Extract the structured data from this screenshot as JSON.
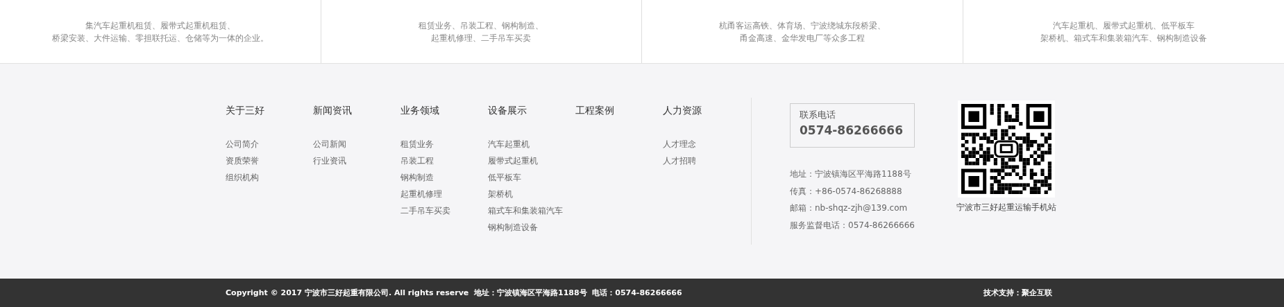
{
  "summary_cards": [
    {
      "lines": [
        "集汽车起重机租赁、履带式起重机租赁、",
        "桥梁安装、大件运输、零担联托运、仓储等为一体的企业。"
      ]
    },
    {
      "lines": [
        "租赁业务、吊装工程、钢构制造、",
        "起重机修理、二手吊车买卖"
      ]
    },
    {
      "lines": [
        "杭甬客运高铁、体育场、宁波绕城东段桥梁、",
        "甬金高速、金华发电厂等众多工程"
      ]
    },
    {
      "lines": [
        "汽车起重机、履带式起重机、低平板车",
        "架桥机、箱式车和集装箱汽车、钢构制造设备"
      ]
    }
  ],
  "footer_nav": [
    {
      "heading": "关于三好",
      "links": [
        "公司简介",
        "资质荣誉",
        "组织机构"
      ]
    },
    {
      "heading": "新闻资讯",
      "links": [
        "公司新闻",
        "行业资讯"
      ]
    },
    {
      "heading": "业务领域",
      "links": [
        "租赁业务",
        "吊装工程",
        "钢构制造",
        "起重机修理",
        "二手吊车买卖"
      ]
    },
    {
      "heading": "设备展示",
      "links": [
        "汽车起重机",
        "履带式起重机",
        "低平板车",
        "架桥机",
        "箱式车和集装箱汽车",
        "钢构制造设备"
      ]
    },
    {
      "heading": "工程案例"
    },
    {
      "heading": "人力资源",
      "links": [
        "人才理念",
        "人才招聘"
      ]
    }
  ],
  "contact": {
    "phone_label": "联系电话",
    "phone": "0574-86266666",
    "details": [
      "地址：宁波镇海区平海路1188号",
      "传真：+86-0574-86268888",
      "邮箱：nb-shqz-zjh@139.com",
      "服务监督电话：0574-86266666"
    ]
  },
  "qr": {
    "caption": "宁波市三好起重运输手机站"
  },
  "bottom_bar": {
    "copyright": "Copyright © 2017 宁波市三好起重有限公司. All rights reserve  地址：宁波镇海区平海路1188号  电话：0574-86266666",
    "support": "技术支持：聚企互联"
  }
}
